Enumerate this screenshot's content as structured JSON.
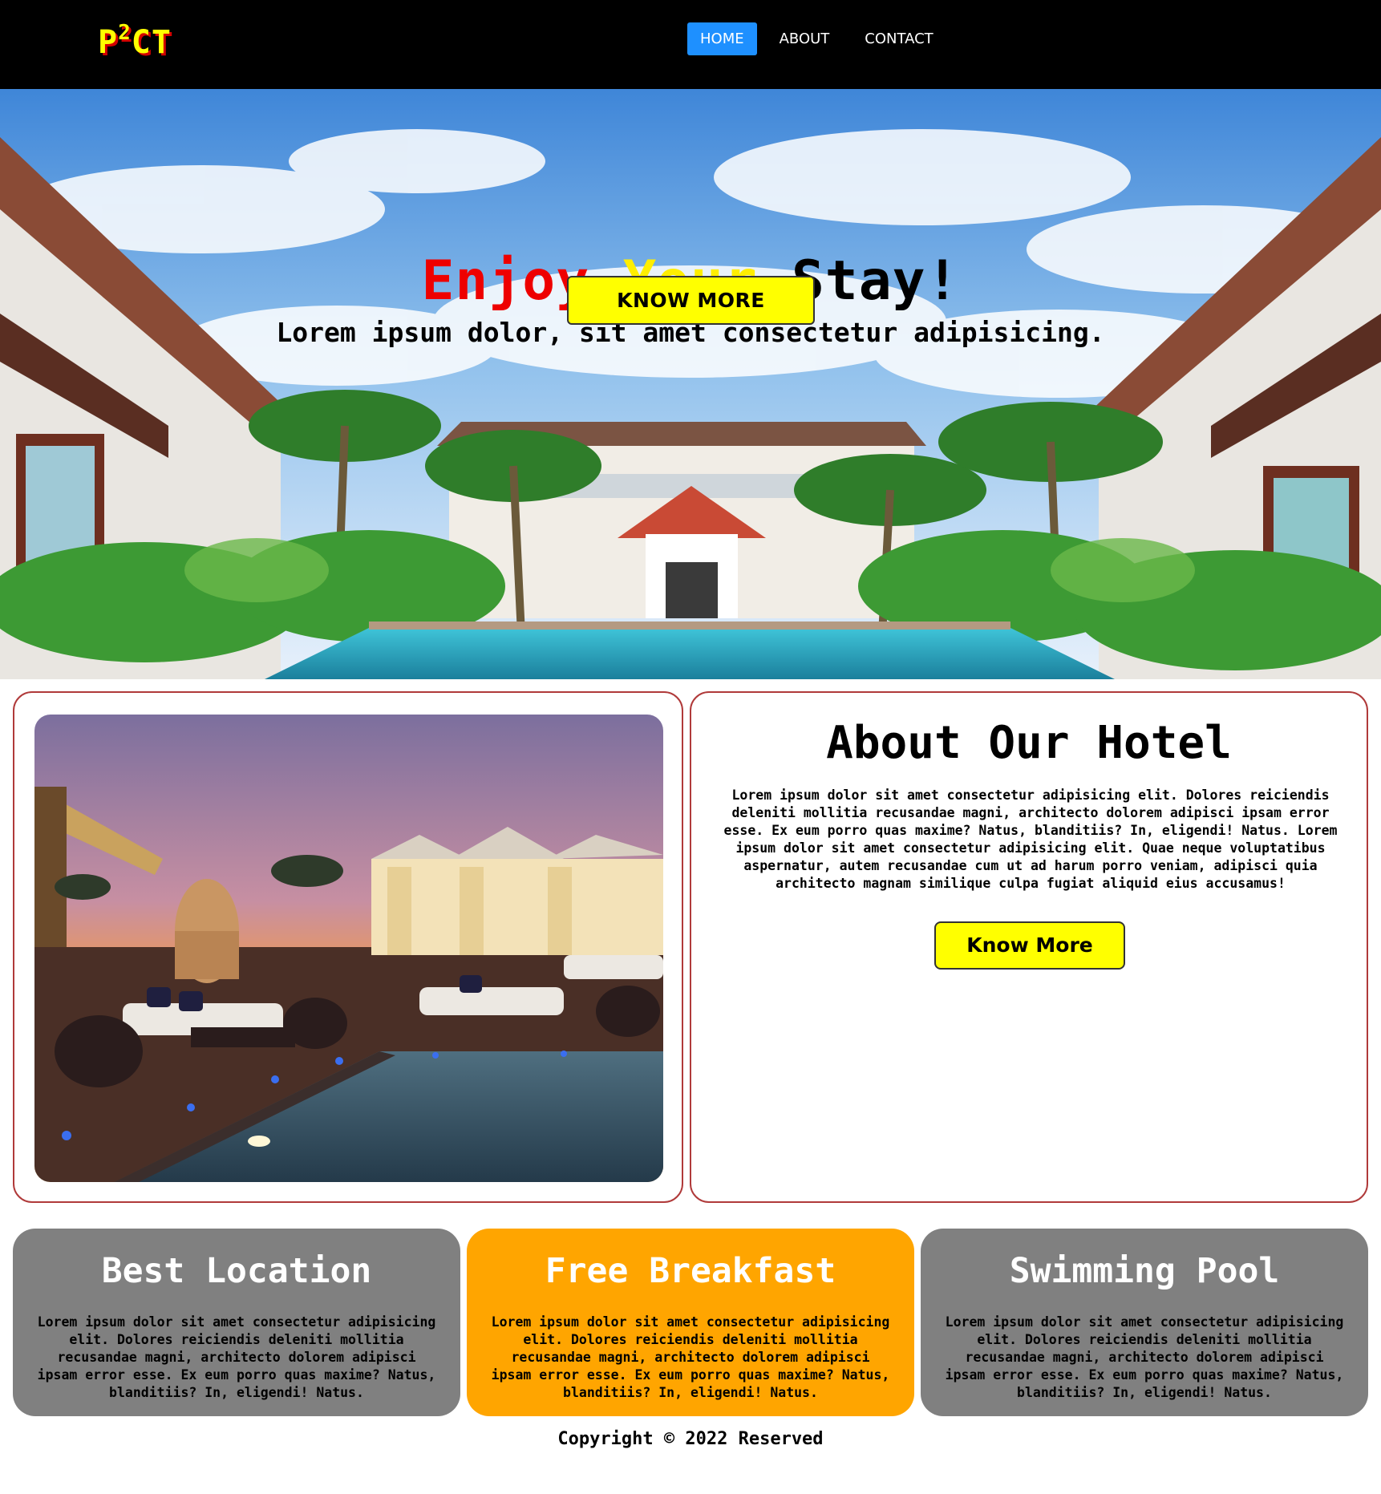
{
  "nav": {
    "logo_main": "P",
    "logo_sup": "2",
    "logo_end": "CT",
    "items": [
      {
        "label": "HOME",
        "active": true
      },
      {
        "label": "ABOUT",
        "active": false
      },
      {
        "label": "CONTACT",
        "active": false
      }
    ],
    "active_color": "#1e90ff"
  },
  "hero": {
    "title_word1": "Enjoy",
    "title_word2": "Your",
    "title_word3": "Stay!",
    "subtitle": "Lorem ipsum dolor, sit amet consectetur adipisicing.",
    "button_label": "KNOW MORE",
    "title_colors": [
      "#ee0000",
      "#ffee00",
      "#000000"
    ]
  },
  "about": {
    "title": "About Our Hotel",
    "text": "Lorem ipsum dolor sit amet consectetur adipisicing elit. Dolores reiciendis deleniti mollitia recusandae magni, architecto dolorem adipisci ipsam error esse. Ex eum porro quas maxime? Natus, blanditiis? In, eligendi! Natus. Lorem ipsum dolor sit amet consectetur adipisicing elit. Quae neque voluptatibus aspernatur, autem recusandae cum ut ad harum porro veniam, adipisci quia architecto magnam similique culpa fugiat aliquid eius accusamus!",
    "button_label": "Know More"
  },
  "features": [
    {
      "title": "Best Location",
      "text": "Lorem ipsum dolor sit amet consectetur adipisicing elit. Dolores reiciendis deleniti mollitia recusandae magni, architecto dolorem adipisci ipsam error esse. Ex eum porro quas maxime? Natus, blanditiis? In, eligendi! Natus.",
      "color": "#808080"
    },
    {
      "title": "Free Breakfast",
      "text": "Lorem ipsum dolor sit amet consectetur adipisicing elit. Dolores reiciendis deleniti mollitia recusandae magni, architecto dolorem adipisci ipsam error esse. Ex eum porro quas maxime? Natus, blanditiis? In, eligendi! Natus.",
      "color": "#ffa500"
    },
    {
      "title": "Swimming Pool",
      "text": "Lorem ipsum dolor sit amet consectetur adipisicing elit. Dolores reiciendis deleniti mollitia recusandae magni, architecto dolorem adipisci ipsam error esse. Ex eum porro quas maxime? Natus, blanditiis? In, eligendi! Natus.",
      "color": "#808080"
    }
  ],
  "footer": {
    "copyright": "Copyright © 2022 Reserved"
  }
}
